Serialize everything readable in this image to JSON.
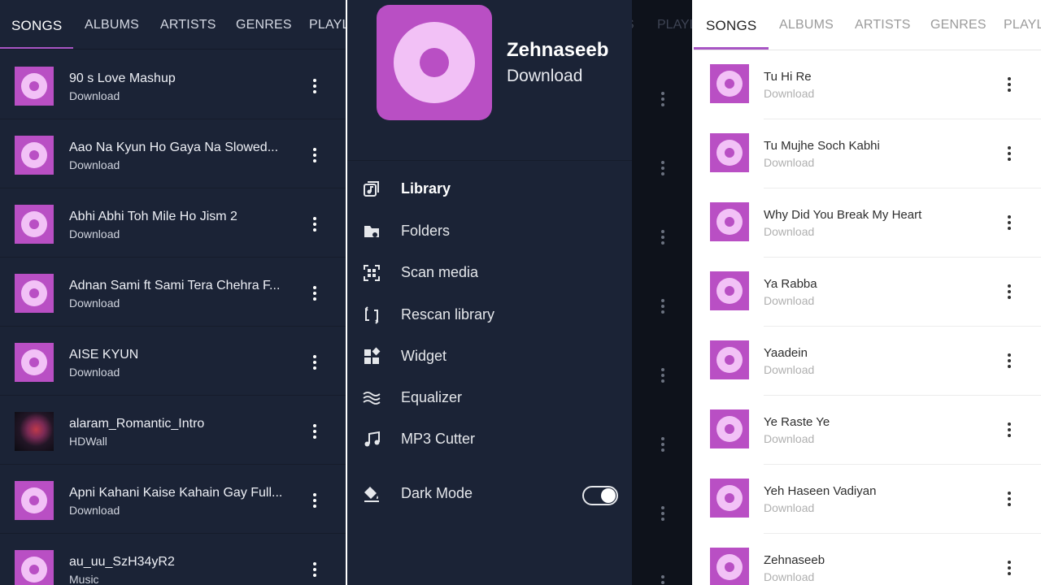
{
  "colors": {
    "accent": "#a855c4",
    "thumb": "#b94fc4",
    "dark_bg": "#1b2336",
    "light_bg": "#ffffff"
  },
  "left_panel": {
    "tabs": [
      "SONGS",
      "ALBUMS",
      "ARTISTS",
      "GENRES",
      "PLAYL"
    ],
    "songs": [
      {
        "title": "90 s Love Mashup",
        "subtitle": "Download",
        "art": "disc-icon"
      },
      {
        "title": "Aao Na  Kyun Ho Gaya Na Slowed...",
        "subtitle": "Download",
        "art": "disc-icon"
      },
      {
        "title": "Abhi Abhi Toh Mile Ho  Jism 2",
        "subtitle": "Download",
        "art": "disc-icon"
      },
      {
        "title": "Adnan Sami ft Sami  Tera Chehra F...",
        "subtitle": "Download",
        "art": "disc-icon"
      },
      {
        "title": "AISE KYUN",
        "subtitle": "Download",
        "art": "disc-icon"
      },
      {
        "title": "alaram_Romantic_Intro",
        "subtitle": "HDWall",
        "art": "album-art"
      },
      {
        "title": "Apni Kahani Kaise Kahain Gay Full...",
        "subtitle": "Download",
        "art": "disc-icon"
      },
      {
        "title": "au_uu_SzH34yR2",
        "subtitle": "Music",
        "art": "disc-icon"
      }
    ]
  },
  "middle_panel": {
    "background_tabs": [
      "S",
      "PLAYL"
    ],
    "now_playing": {
      "title": "Zehnaseeb",
      "subtitle": "Download"
    },
    "menu": [
      {
        "label": "Library",
        "icon": "library-icon",
        "active": true
      },
      {
        "label": "Folders",
        "icon": "folder-icon",
        "active": false
      },
      {
        "label": "Scan media",
        "icon": "scan-icon",
        "active": false
      },
      {
        "label": "Rescan library",
        "icon": "rescan-icon",
        "active": false
      },
      {
        "label": "Widget",
        "icon": "widget-icon",
        "active": false
      },
      {
        "label": "Equalizer",
        "icon": "equalizer-icon",
        "active": false
      },
      {
        "label": "MP3 Cutter",
        "icon": "music-note-icon",
        "active": false
      }
    ],
    "dark_mode": {
      "label": "Dark Mode",
      "icon": "paint-bucket-icon",
      "enabled": true
    }
  },
  "right_panel": {
    "tabs": [
      "SONGS",
      "ALBUMS",
      "ARTISTS",
      "GENRES",
      "PLAYL"
    ],
    "songs": [
      {
        "title": "Tu Hi Re",
        "subtitle": "Download"
      },
      {
        "title": "Tu Mujhe Soch Kabhi",
        "subtitle": "Download"
      },
      {
        "title": "Why Did You Break My Heart",
        "subtitle": "Download"
      },
      {
        "title": "Ya Rabba",
        "subtitle": "Download"
      },
      {
        "title": "Yaadein",
        "subtitle": "Download"
      },
      {
        "title": "Ye Raste Ye",
        "subtitle": "Download"
      },
      {
        "title": "Yeh Haseen Vadiyan",
        "subtitle": "Download"
      },
      {
        "title": "Zehnaseeb",
        "subtitle": "Download"
      }
    ]
  }
}
